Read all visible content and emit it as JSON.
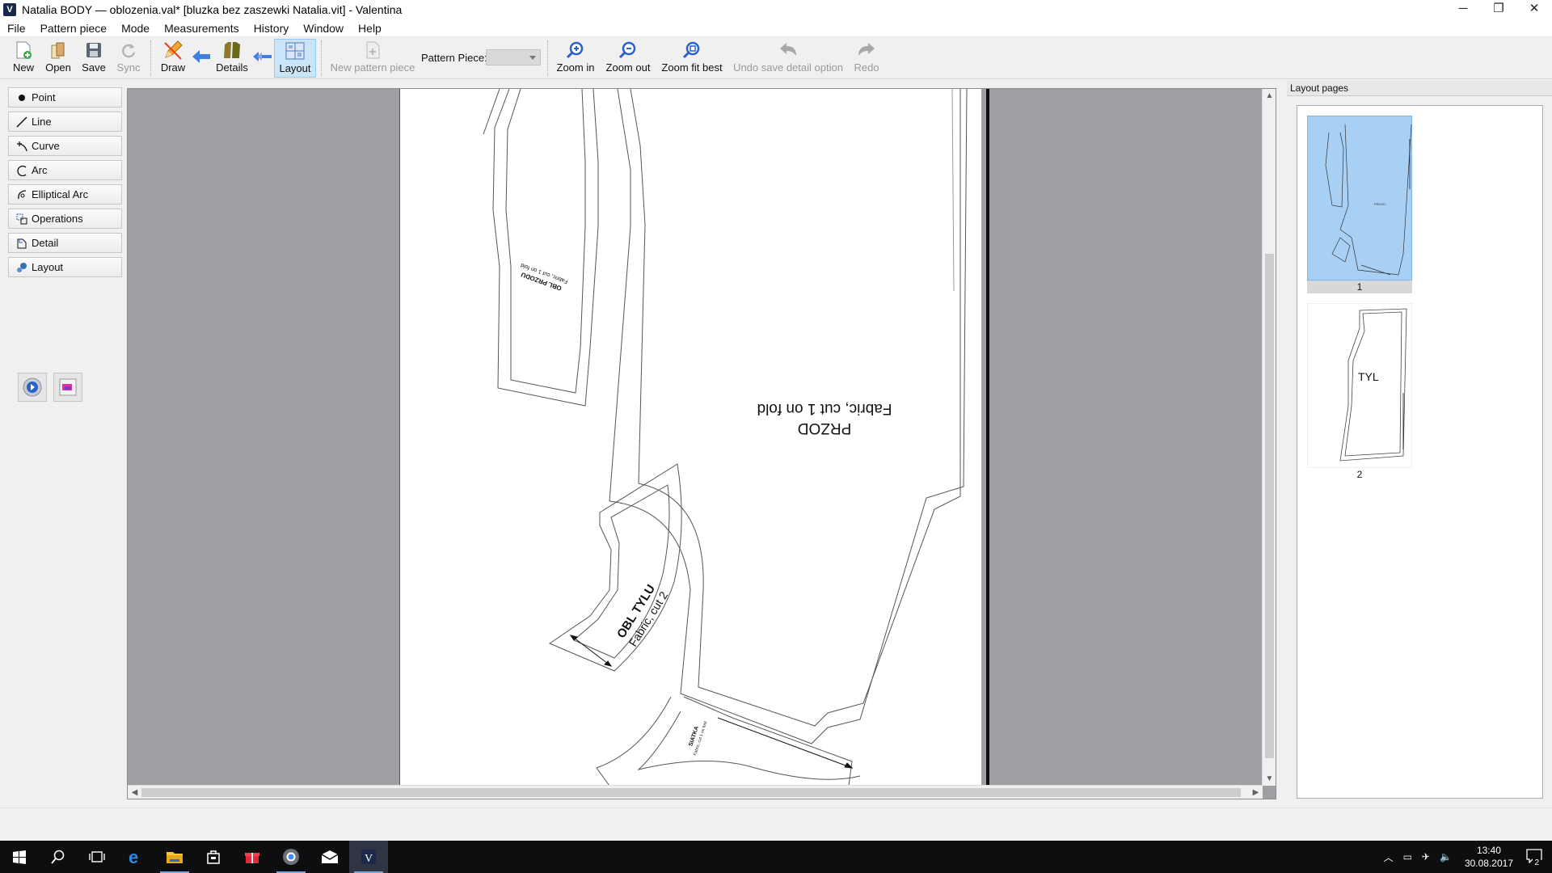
{
  "window": {
    "title": "Natalia BODY — oblozenia.val* [bluzka bez zaszewki Natalia.vit] - Valentina",
    "minimize": "─",
    "restore": "❐",
    "close": "✕"
  },
  "menu": [
    "File",
    "Pattern piece",
    "Mode",
    "Measurements",
    "History",
    "Window",
    "Help"
  ],
  "toolbar": {
    "new": "New",
    "open": "Open",
    "save": "Save",
    "sync": "Sync",
    "draw": "Draw",
    "details": "Details",
    "layout": "Layout",
    "new_pattern_piece": "New pattern piece",
    "pattern_piece_label": "Pattern Piece:",
    "zoom_in": "Zoom in",
    "zoom_out": "Zoom out",
    "zoom_fit_best": "Zoom fit best",
    "undo_save_detail": "Undo save detail option",
    "redo": "Redo"
  },
  "tools": [
    "Point",
    "Line",
    "Curve",
    "Arc",
    "Elliptical Arc",
    "Operations",
    "Detail",
    "Layout"
  ],
  "scene": {
    "labels": {
      "przod_name": "PRZOD",
      "przod_cut": "Fabric, cut 1 on fold",
      "obl_tylu_name": "OBL TYLU",
      "obl_tylu_cut": "Fabric, cut 2",
      "obl_przodu_name": "OBL PRZODU",
      "obl_przodu_cut": "Fabric, cut 1 on fold",
      "siatka_name": "SIATKA",
      "siatka_cut": "Fabric, cut 1 on fold"
    }
  },
  "layout_pages": {
    "title": "Layout pages",
    "pages": [
      {
        "number": "1",
        "label": "",
        "selected": true
      },
      {
        "number": "2",
        "label": "TYL",
        "selected": false
      }
    ]
  },
  "taskbar": {
    "time": "13:40",
    "date": "30.08.2017",
    "notification_count": "2"
  }
}
